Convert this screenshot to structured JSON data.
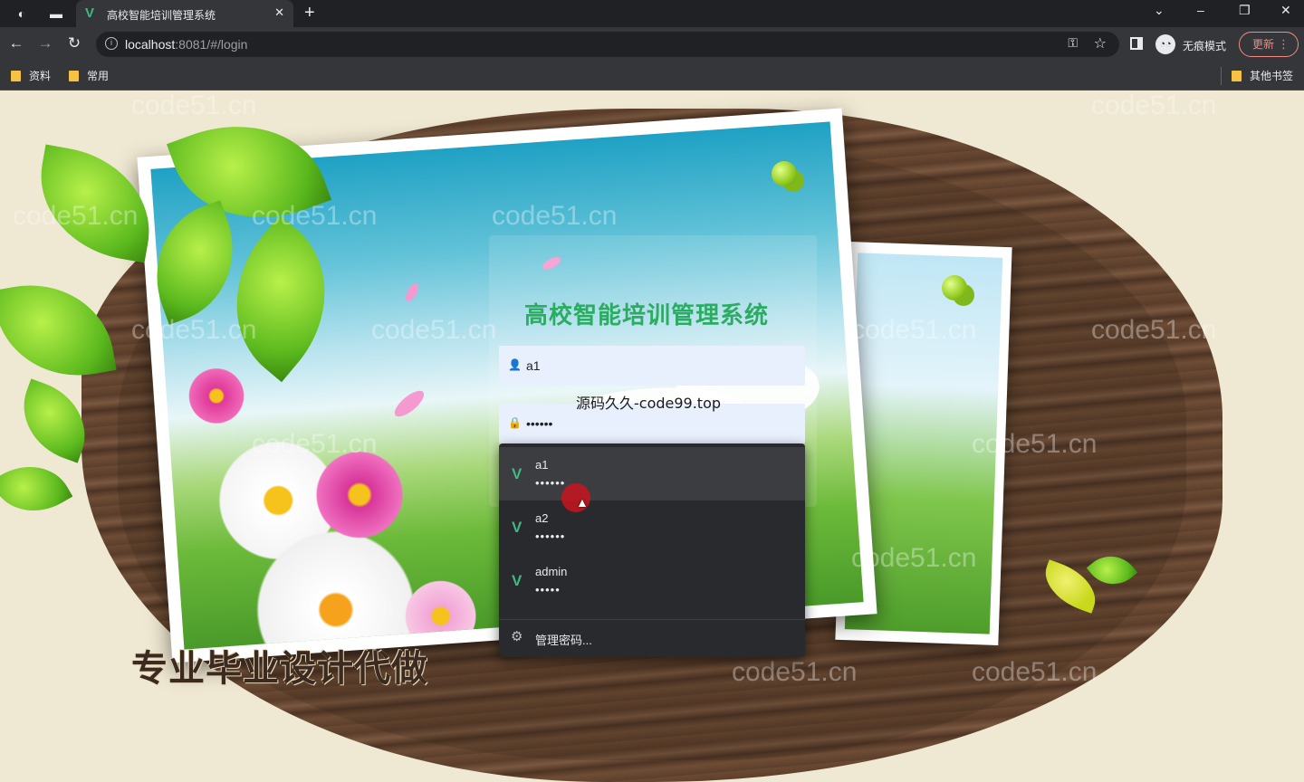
{
  "browser": {
    "tab_title": "高校智能培训管理系统",
    "url_host": "localhost",
    "url_rest": ":8081/#/login",
    "incognito_label": "无痕模式",
    "update_label": "更新",
    "bookmarks": [
      "资料",
      "常用"
    ],
    "other_bookmarks": "其他书签"
  },
  "page": {
    "system_title": "高校智能培训管理系统",
    "username_value": "a1",
    "password_value": "••••••",
    "overlay_text": "源码久久-code99.top",
    "slogan": "专业毕业设计代做",
    "watermark": "code51.cn"
  },
  "autofill": {
    "items": [
      {
        "username": "a1",
        "password": "••••••"
      },
      {
        "username": "a2",
        "password": "••••••"
      },
      {
        "username": "admin",
        "password": "•••••"
      }
    ],
    "manage_label": "管理密码..."
  },
  "colors": {
    "title_green": "#2cab63",
    "vue_green": "#41b883",
    "chrome_dark": "#202124",
    "chrome_mid": "#35363a",
    "update_red": "#f28b82"
  }
}
